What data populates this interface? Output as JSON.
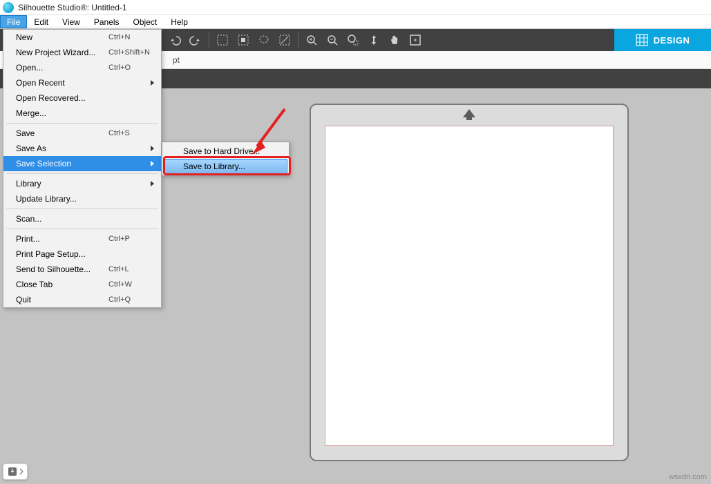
{
  "title": "Silhouette Studio®: Untitled-1",
  "menubar": [
    "File",
    "Edit",
    "View",
    "Panels",
    "Object",
    "Help"
  ],
  "file_menu": {
    "groups": [
      [
        {
          "label": "New",
          "short": "Ctrl+N"
        },
        {
          "label": "New Project Wizard...",
          "short": "Ctrl+Shift+N"
        },
        {
          "label": "Open...",
          "short": "Ctrl+O"
        },
        {
          "label": "Open Recent",
          "sub": true
        },
        {
          "label": "Open Recovered..."
        },
        {
          "label": "Merge..."
        }
      ],
      [
        {
          "label": "Save",
          "short": "Ctrl+S"
        },
        {
          "label": "Save As",
          "sub": true
        },
        {
          "label": "Save Selection",
          "sub": true,
          "hl": true
        }
      ],
      [
        {
          "label": "Library",
          "sub": true
        },
        {
          "label": "Update Library..."
        }
      ],
      [
        {
          "label": "Scan..."
        }
      ],
      [
        {
          "label": "Print...",
          "short": "Ctrl+P"
        },
        {
          "label": "Print Page Setup..."
        },
        {
          "label": "Send to Silhouette...",
          "short": "Ctrl+L"
        },
        {
          "label": "Close Tab",
          "short": "Ctrl+W"
        },
        {
          "label": "Quit",
          "short": "Ctrl+Q"
        }
      ]
    ]
  },
  "submenu": {
    "items": [
      {
        "label": "Save to Hard Drive..."
      },
      {
        "label": "Save to Library...",
        "hl": true
      }
    ]
  },
  "optbar_unit": "pt",
  "design_tab": "DESIGN",
  "watermark": "wsxdn.com"
}
